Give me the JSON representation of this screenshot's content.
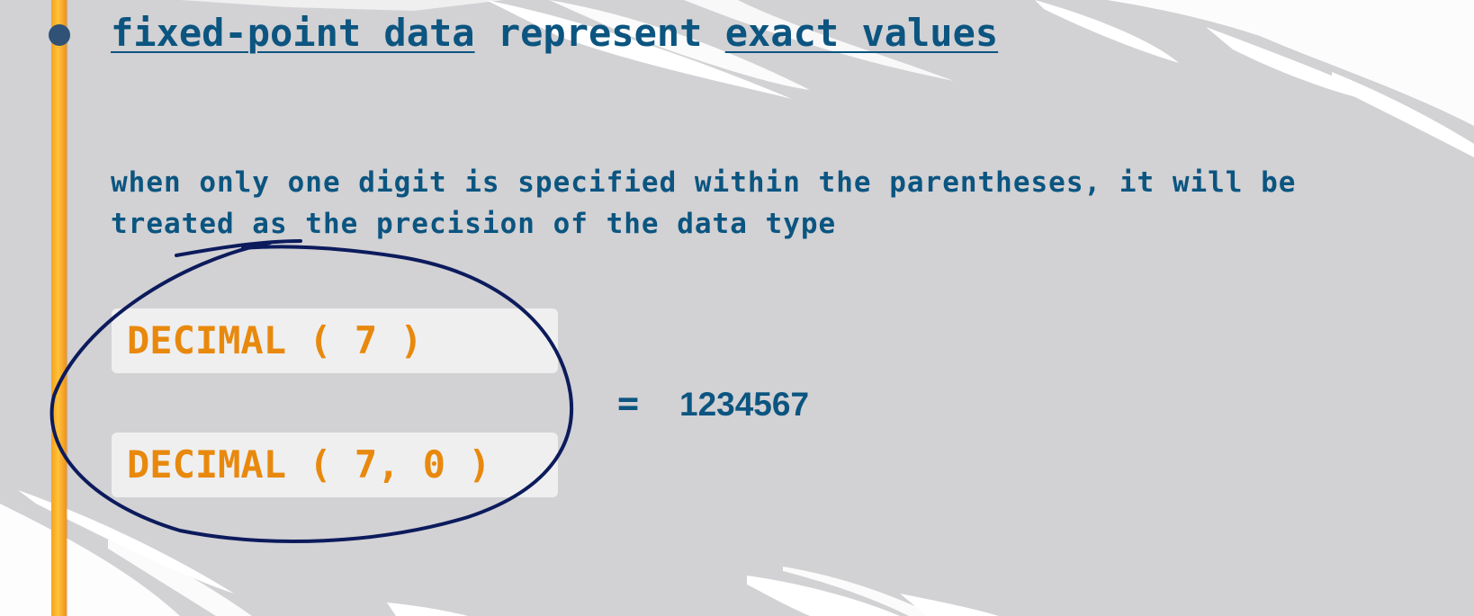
{
  "headline": {
    "term1": "fixed-point data",
    "middle": " represent ",
    "term2": "exact values"
  },
  "note": {
    "line1": "when only one digit is specified within the parentheses, it will be",
    "line2": "treated as the precision of the data type"
  },
  "examples": {
    "short_form": "DECIMAL ( 7 )",
    "full_form": "DECIMAL ( 7, 0 )",
    "equals": "=",
    "value": "1234567"
  },
  "colors": {
    "accent_bar": "#f6a21a",
    "text_blue": "#0b5580",
    "code_orange": "#e8890d",
    "ink": "#0c1b5c",
    "background": "#d2d1d4"
  }
}
